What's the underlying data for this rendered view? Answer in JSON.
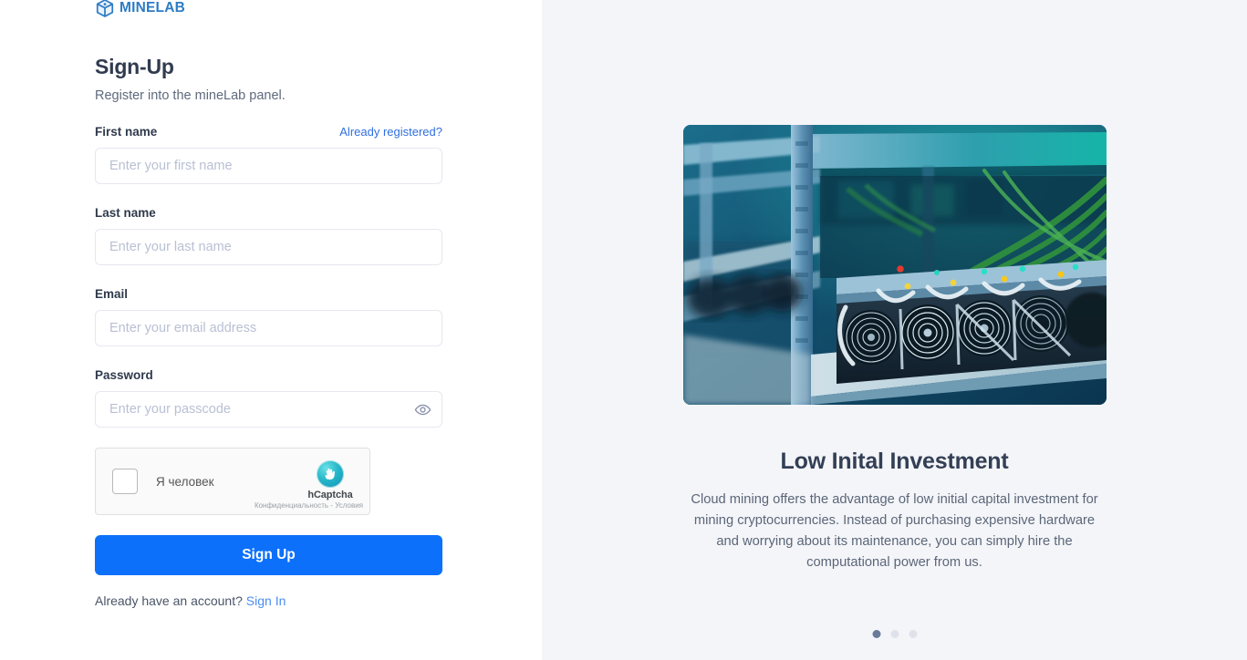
{
  "brand": {
    "name": "MINELAB",
    "mark_icon": "cube-box-icon",
    "color": "#2d7cc4"
  },
  "form": {
    "title": "Sign-Up",
    "subtitle": "Register into the mineLab panel.",
    "already_registered_link": "Already registered?",
    "fields": [
      {
        "label": "First name",
        "placeholder": "Enter your first name",
        "value": "",
        "type": "text"
      },
      {
        "label": "Last name",
        "placeholder": "Enter your last name",
        "value": "",
        "type": "text"
      },
      {
        "label": "Email",
        "placeholder": "Enter your email address",
        "value": "",
        "type": "email"
      },
      {
        "label": "Password",
        "placeholder": "Enter your passcode",
        "value": "",
        "type": "password"
      }
    ],
    "password_toggle_icon": "eye-icon",
    "submit_label": "Sign Up",
    "footer_text": "Already have an account?",
    "footer_link": "Sign In",
    "submit_color": "#0c70fa",
    "link_color": "#2f6fe0"
  },
  "captcha": {
    "checkbox_label": "Я человек",
    "brand_name": "hCaptcha",
    "legal": "Конфиденциальность - Условия",
    "logo_icon": "hcaptcha-hand-icon",
    "checked": false
  },
  "promo": {
    "image_alt": "crypto-mining-rig-photo",
    "title": "Low Inital Investment",
    "body": "Cloud mining offers the advantage of low initial capital investment for mining cryptocurrencies. Instead of purchasing expensive hardware and worrying about its maintenance, you can simply hire the computational power from us.",
    "dots": [
      {
        "active": true
      },
      {
        "active": false
      },
      {
        "active": false
      }
    ]
  }
}
